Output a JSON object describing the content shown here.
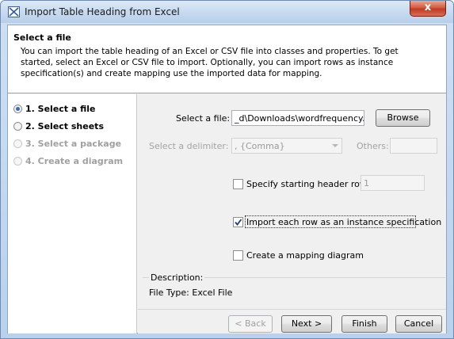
{
  "window": {
    "title": "Import Table Heading from Excel",
    "close_label": "x"
  },
  "header": {
    "title": "Select a file",
    "description": "You can import the table heading of an Excel or CSV file into classes and properties. To get started, select an Excel or CSV file to import. Optionally, you can import rows as instance specification(s) and create mapping use the imported data for mapping."
  },
  "steps": [
    {
      "label": "1. Select a file",
      "selected": true,
      "enabled": true
    },
    {
      "label": "2. Select sheets",
      "selected": false,
      "enabled": true
    },
    {
      "label": "3. Select a package",
      "selected": false,
      "enabled": false
    },
    {
      "label": "4. Create a diagram",
      "selected": false,
      "enabled": false
    }
  ],
  "form": {
    "file_label": "Select a file:",
    "file_value": "_d\\Downloads\\wordfrequency.xls",
    "browse_label": "Browse",
    "delimiter_label": "Select a delimiter:",
    "delimiter_value": ", {Comma}",
    "others_label": "Others:",
    "others_value": "",
    "header_row_label": "Specify starting header row",
    "header_row_checked": false,
    "header_row_value": "1",
    "import_rows_label": "Import each row as an instance specification",
    "import_rows_checked": true,
    "mapping_label": "Create a mapping diagram",
    "mapping_checked": false
  },
  "description": {
    "label": "Description:",
    "value": "File Type: Excel File"
  },
  "buttons": {
    "back": "< Back",
    "next": "Next >",
    "finish": "Finish",
    "cancel": "Cancel"
  },
  "colors": {
    "accent": "#3a6ea5",
    "close": "#c03a22",
    "title_bar": "#c4d8ef"
  }
}
